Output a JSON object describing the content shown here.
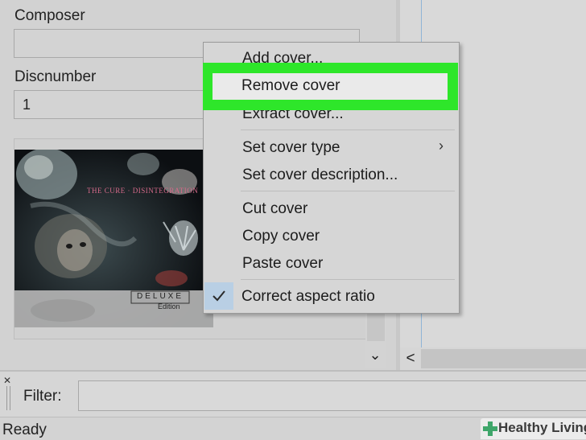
{
  "fields": {
    "composer_label": "Composer",
    "composer_value": "",
    "discnumber_label": "Discnumber",
    "discnumber_value": "1"
  },
  "cover_art": {
    "title_text": "THE CURE · DISINTEGRATION",
    "badge_text": "DELUXE",
    "edition_text": "Edition"
  },
  "context_menu": {
    "items": [
      {
        "label": "Add cover..."
      },
      {
        "label": "Remove cover"
      },
      {
        "label": "Extract cover..."
      },
      {
        "label": "Set cover type"
      },
      {
        "label": "Set cover description..."
      },
      {
        "label": "Cut cover"
      },
      {
        "label": "Copy cover"
      },
      {
        "label": "Paste cover"
      },
      {
        "label": "Correct aspect ratio"
      }
    ],
    "highlight_color": "#2ee62a",
    "checked_bg_color": "#b9cfe4"
  },
  "scrollbars": {
    "down_arrow": "⌄",
    "left_arrow": "<"
  },
  "filter": {
    "label": "Filter:",
    "value": ""
  },
  "status": {
    "text": "Ready"
  },
  "watermark": {
    "text": "Healthy Living"
  }
}
